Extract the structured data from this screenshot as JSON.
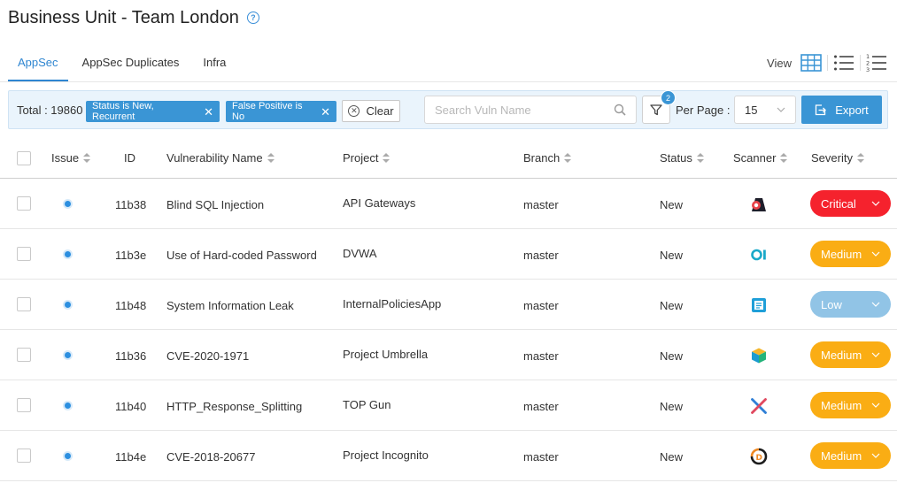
{
  "page": {
    "title": "Business Unit - Team London",
    "help": "?"
  },
  "tabs": [
    {
      "label": "AppSec",
      "active": true
    },
    {
      "label": "AppSec Duplicates",
      "active": false
    },
    {
      "label": "Infra",
      "active": false
    }
  ],
  "view": {
    "label": "View"
  },
  "filters": {
    "total_label": "Total : 19860",
    "chips": [
      {
        "label": "Status is New, Recurrent"
      },
      {
        "label": "False Positive is No"
      }
    ],
    "clear_label": "Clear",
    "search_placeholder": "Search Vuln Name",
    "filter_count": "2",
    "per_page_label": "Per Page :",
    "per_page_value": "15",
    "export_label": "Export"
  },
  "table": {
    "columns": {
      "issue": "Issue",
      "id": "ID",
      "vuln": "Vulnerability Name",
      "project": "Project",
      "branch": "Branch",
      "status": "Status",
      "scanner": "Scanner",
      "severity": "Severity"
    },
    "rows": [
      {
        "id": "11b38",
        "vuln": "Blind SQL Injection",
        "project": "API Gateways",
        "branch": "master",
        "status": "New",
        "scanner_icon": "scanner-a-icon",
        "severity": "Critical"
      },
      {
        "id": "11b3e",
        "vuln": "Use of Hard-coded Password",
        "project": "DVWA",
        "branch": "master",
        "status": "New",
        "scanner_icon": "scanner-01-icon",
        "severity": "Medium"
      },
      {
        "id": "11b48",
        "vuln": "System Information Leak",
        "project": "InternalPoliciesApp",
        "branch": "master",
        "status": "New",
        "scanner_icon": "scanner-doc-icon",
        "severity": "Low"
      },
      {
        "id": "11b36",
        "vuln": "CVE-2020-1971",
        "project": "Project Umbrella",
        "branch": "master",
        "status": "New",
        "scanner_icon": "scanner-cube-icon",
        "severity": "Medium"
      },
      {
        "id": "11b40",
        "vuln": "HTTP_Response_Splitting",
        "project": "TOP Gun",
        "branch": "master",
        "status": "New",
        "scanner_icon": "scanner-x-icon",
        "severity": "Medium"
      },
      {
        "id": "11b4e",
        "vuln": "CVE-2018-20677",
        "project": "Project Incognito",
        "branch": "master",
        "status": "New",
        "scanner_icon": "scanner-d-icon",
        "severity": "Medium"
      }
    ]
  },
  "colors": {
    "accent": "#3a95d5",
    "critical": "#f5222d",
    "medium": "#faad14",
    "low": "#91c4e6"
  }
}
